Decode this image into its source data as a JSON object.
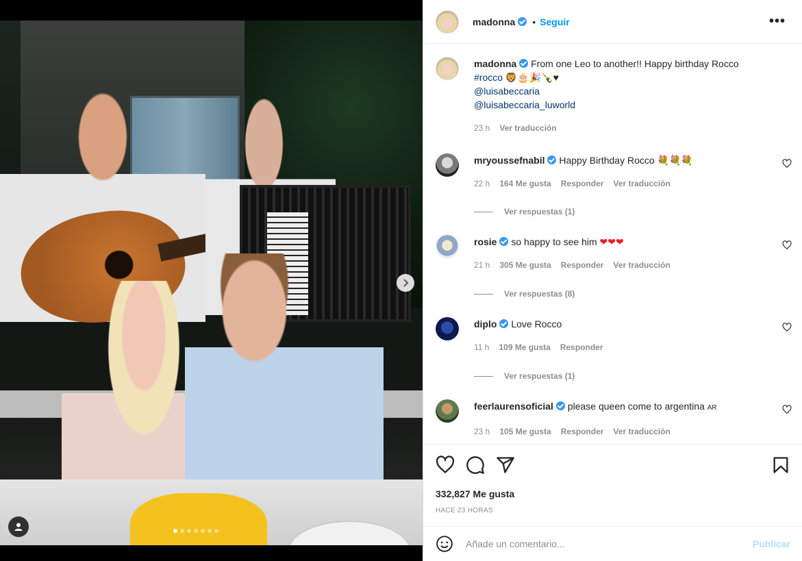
{
  "post": {
    "media": {
      "next_icon": "chevron-right-icon",
      "tag_icon": "user-tag-icon",
      "carousel_count": 7,
      "carousel_active_index": 0
    },
    "header": {
      "username": "madonna",
      "bullet": "•",
      "follow_label": "Seguir",
      "more_label": "•••"
    },
    "caption": {
      "username": "madonna",
      "text": "From one Leo to another!! Happy birthday Rocco",
      "hashtag": "#rocco",
      "emojis": "🦁🎂🎉🍾♥",
      "mentions": [
        "@luisabeccaria",
        "@luisabeccaria_luworld"
      ],
      "time": "23 h",
      "translate": "Ver traducción"
    },
    "comments": [
      {
        "username": "mryoussefnabil",
        "text": "Happy Birthday Rocco 💐💐💐",
        "time": "22 h",
        "likes": "164 Me gusta",
        "reply": "Responder",
        "translate": "Ver traducción",
        "replies": "Ver respuestas (1)"
      },
      {
        "username": "rosie",
        "text": "so happy to see him",
        "hearts": "❤❤❤",
        "time": "21 h",
        "likes": "305 Me gusta",
        "reply": "Responder",
        "translate": "Ver traducción",
        "replies": "Ver respuestas (8)"
      },
      {
        "username": "diplo",
        "text": "Love Rocco",
        "time": "11 h",
        "likes": "109 Me gusta",
        "reply": "Responder",
        "replies": "Ver respuestas (1)"
      },
      {
        "username": "feerlaurensoficial",
        "text": "please queen come to argentina",
        "flag": "AR",
        "time": "23 h",
        "likes": "105 Me gusta",
        "reply": "Responder",
        "translate": "Ver traducción"
      }
    ],
    "actions": {
      "like_icon": "heart-icon",
      "comment_icon": "comment-icon",
      "share_icon": "share-icon",
      "save_icon": "bookmark-icon"
    },
    "likes": "332,827 Me gusta",
    "time_ago": "HACE 23 HORAS",
    "add_comment": {
      "emoji_icon": "smiley-icon",
      "placeholder": "Añade un comentario...",
      "publish_label": "Publicar"
    },
    "colors": {
      "accent": "#0095f6",
      "verified": "#3897f0",
      "link": "#00376b",
      "muted": "#8e8e8e",
      "publish_disabled": "#b2dffc"
    }
  }
}
